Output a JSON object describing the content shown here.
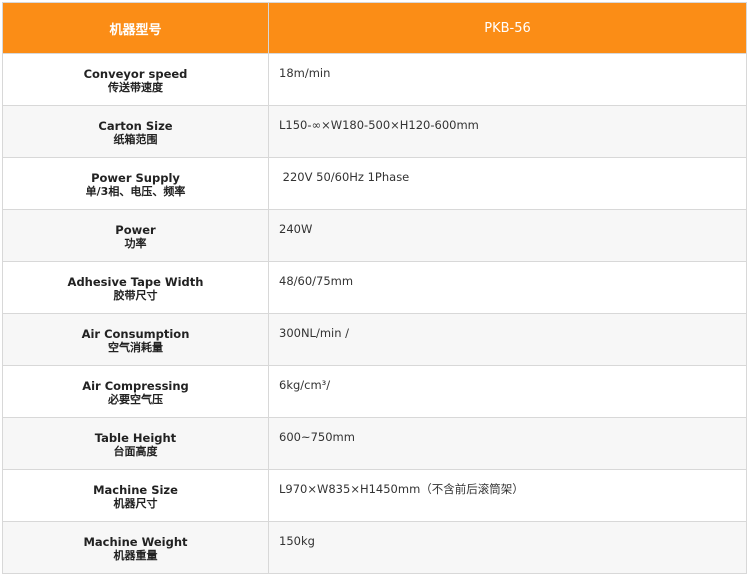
{
  "header": {
    "label": "机器型号",
    "model": "PKB-56"
  },
  "rows": [
    {
      "en": "Conveyor speed",
      "zh": "传送带速度",
      "value": "18m/min"
    },
    {
      "en": "Carton Size",
      "zh": "纸箱范围",
      "value": "L150-∞×W180-500×H120-600mm"
    },
    {
      "en": "Power Supply",
      "zh": "单/3相、电压、频率",
      "value": " 220V 50/60Hz 1Phase"
    },
    {
      "en": "Power",
      "zh": "功率",
      "value": "240W"
    },
    {
      "en": "Adhesive Tape Width",
      "zh": "胶带尺寸",
      "value": "48/60/75mm"
    },
    {
      "en": "Air Consumption",
      "zh": "空气消耗量",
      "value": "300NL/min /"
    },
    {
      "en": "Air Compressing",
      "zh": "必要空气压",
      "value": "6kg/cm³/"
    },
    {
      "en": "Table Height",
      "zh": "台面高度",
      "value": "600~750mm"
    },
    {
      "en": "Machine Size",
      "zh": "机器尺寸",
      "value": "L970×W835×H1450mm（不含前后滚筒架）"
    },
    {
      "en": "Machine Weight",
      "zh": "机器重量",
      "value": "150kg"
    }
  ]
}
